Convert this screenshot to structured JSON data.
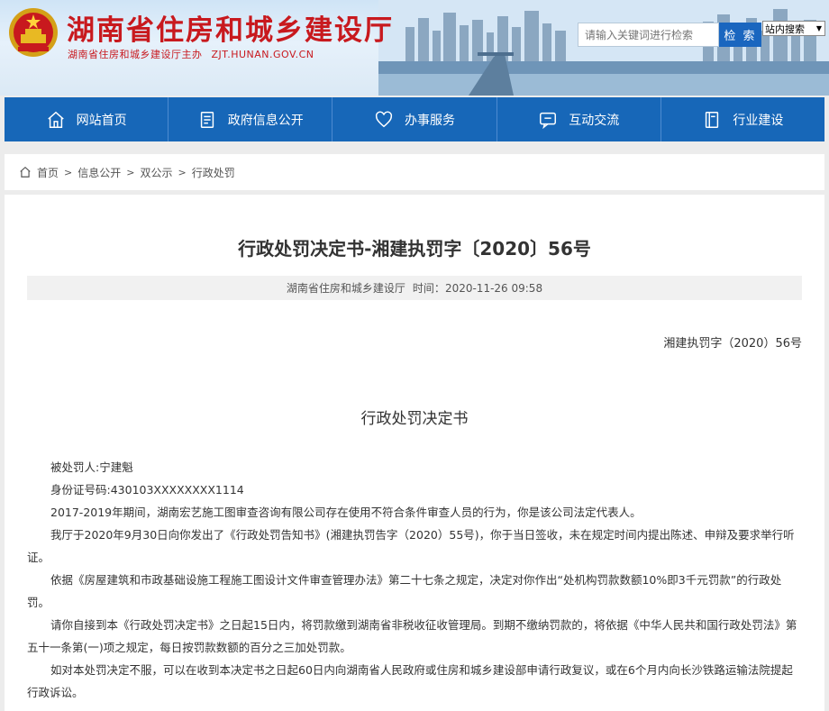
{
  "header": {
    "site_title": "湖南省住房和城乡建设厅",
    "sponsor": "湖南省住房和城乡建设厅主办",
    "domain": "ZJT.HUNAN.GOV.CN",
    "search_placeholder": "请输入关键词进行检索",
    "search_button": "检 索",
    "search_scope": "站内搜索",
    "brand_red": "#c8191e"
  },
  "nav": {
    "color": "#1767b8",
    "items": [
      {
        "label": "网站首页",
        "icon": "home-icon"
      },
      {
        "label": "政府信息公开",
        "icon": "document-icon"
      },
      {
        "label": "办事服务",
        "icon": "heart-icon"
      },
      {
        "label": "互动交流",
        "icon": "chat-icon"
      },
      {
        "label": "行业建设",
        "icon": "book-icon"
      }
    ]
  },
  "breadcrumb": [
    "首页",
    "信息公开",
    "双公示",
    "行政处罚"
  ],
  "article": {
    "title": "行政处罚决定书-湘建执罚字〔2020〕56号",
    "source": "湖南省住房和城乡建设厅",
    "time_label": "时间：",
    "time": "2020-11-26 09:58",
    "doc_number": "湘建执罚字（2020）56号",
    "inner_title": "行政处罚决定书",
    "lines": [
      "被处罚人:宁建魁",
      "身份证号码:430103XXXXXXXX1114"
    ],
    "paragraphs": [
      "2017-2019年期间，湖南宏艺施工图审查咨询有限公司存在使用不符合条件审查人员的行为，你是该公司法定代表人。",
      "我厅于2020年9月30日向你发出了《行政处罚告知书》(湘建执罚告字（2020）55号)，你于当日签收，未在规定时间内提出陈述、申辩及要求举行听证。",
      "依据《房屋建筑和市政基础设施工程施工图设计文件审查管理办法》第二十七条之规定，决定对你作出“处机构罚款数额10%即3千元罚款”的行政处罚。",
      "请你自接到本《行政处罚决定书》之日起15日内，将罚款缴到湖南省非税收征收管理局。到期不缴纳罚款的，将依据《中华人民共和国行政处罚法》第五十一条第(一)项之规定，每日按罚款数额的百分之三加处罚款。",
      "如对本处罚决定不服，可以在收到本决定书之日起60日内向湖南省人民政府或住房和城乡建设部申请行政复议，或在6个月内向长沙铁路运输法院提起行政诉讼。"
    ]
  }
}
